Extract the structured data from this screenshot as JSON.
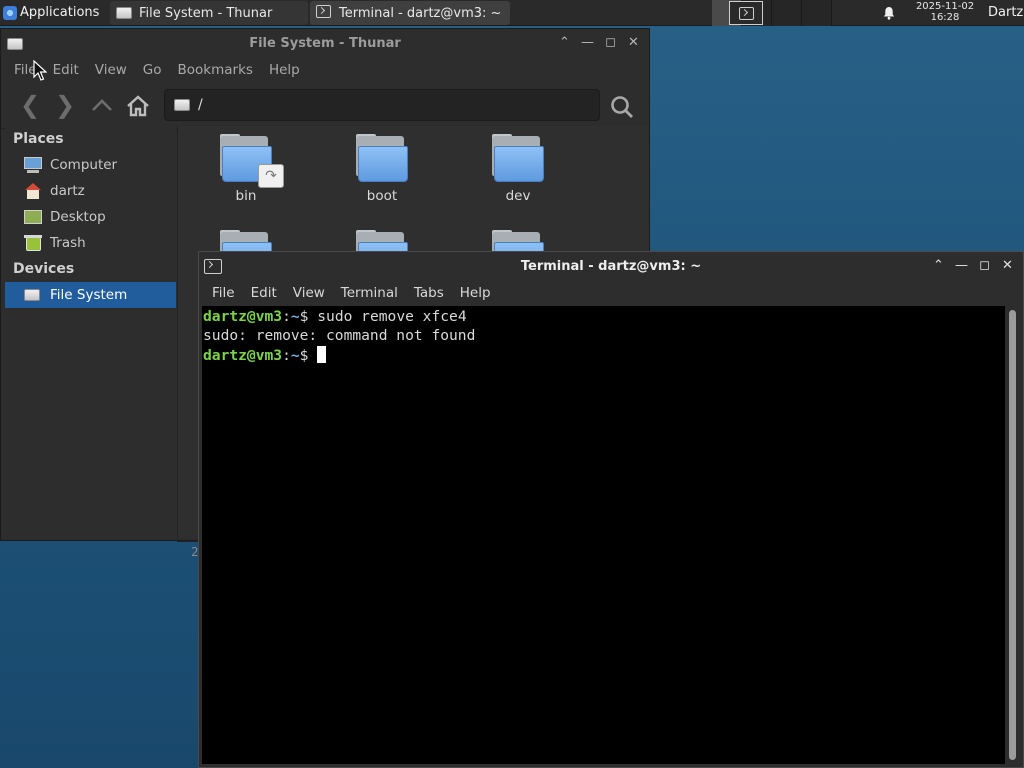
{
  "panel": {
    "applications_label": "Applications",
    "tasks": [
      {
        "label": "File System - Thunar",
        "icon": "drive-icon"
      },
      {
        "label": "Terminal - dartz@vm3: ~",
        "icon": "terminal-icon"
      }
    ],
    "clock": {
      "date": "2025-11-02",
      "time": "16:28"
    },
    "user": "Dartz"
  },
  "thunar": {
    "title": "File System - Thunar",
    "menu": [
      "File",
      "Edit",
      "View",
      "Go",
      "Bookmarks",
      "Help"
    ],
    "address": "/",
    "sidebar": {
      "places_header": "Places",
      "places": [
        {
          "label": "Computer",
          "icon": "computer-icon"
        },
        {
          "label": "dartz",
          "icon": "home-icon"
        },
        {
          "label": "Desktop",
          "icon": "desktop-icon"
        },
        {
          "label": "Trash",
          "icon": "trash-icon"
        }
      ],
      "devices_header": "Devices",
      "devices": [
        {
          "label": "File System",
          "icon": "drive-icon",
          "selected": true
        }
      ]
    },
    "files": [
      {
        "name": "bin",
        "icon": "folder-link-icon"
      },
      {
        "name": "boot",
        "icon": "folder-icon"
      },
      {
        "name": "dev",
        "icon": "folder-icon"
      }
    ],
    "status_fragment": "2"
  },
  "terminal": {
    "title": "Terminal - dartz@vm3: ~",
    "menu": [
      "File",
      "Edit",
      "View",
      "Terminal",
      "Tabs",
      "Help"
    ],
    "lines": [
      {
        "user": "dartz@vm3",
        "sep": ":",
        "path": "~",
        "symbol": "$ ",
        "command": "sudo remove xfce4"
      },
      {
        "output": "sudo: remove: command not found"
      },
      {
        "user": "dartz@vm3",
        "sep": ":",
        "path": "~",
        "symbol": "$ ",
        "command": ""
      }
    ],
    "colors": {
      "prompt_user": "#7bd44a",
      "prompt_path": "#7ea8e0",
      "background": "#000000"
    }
  }
}
